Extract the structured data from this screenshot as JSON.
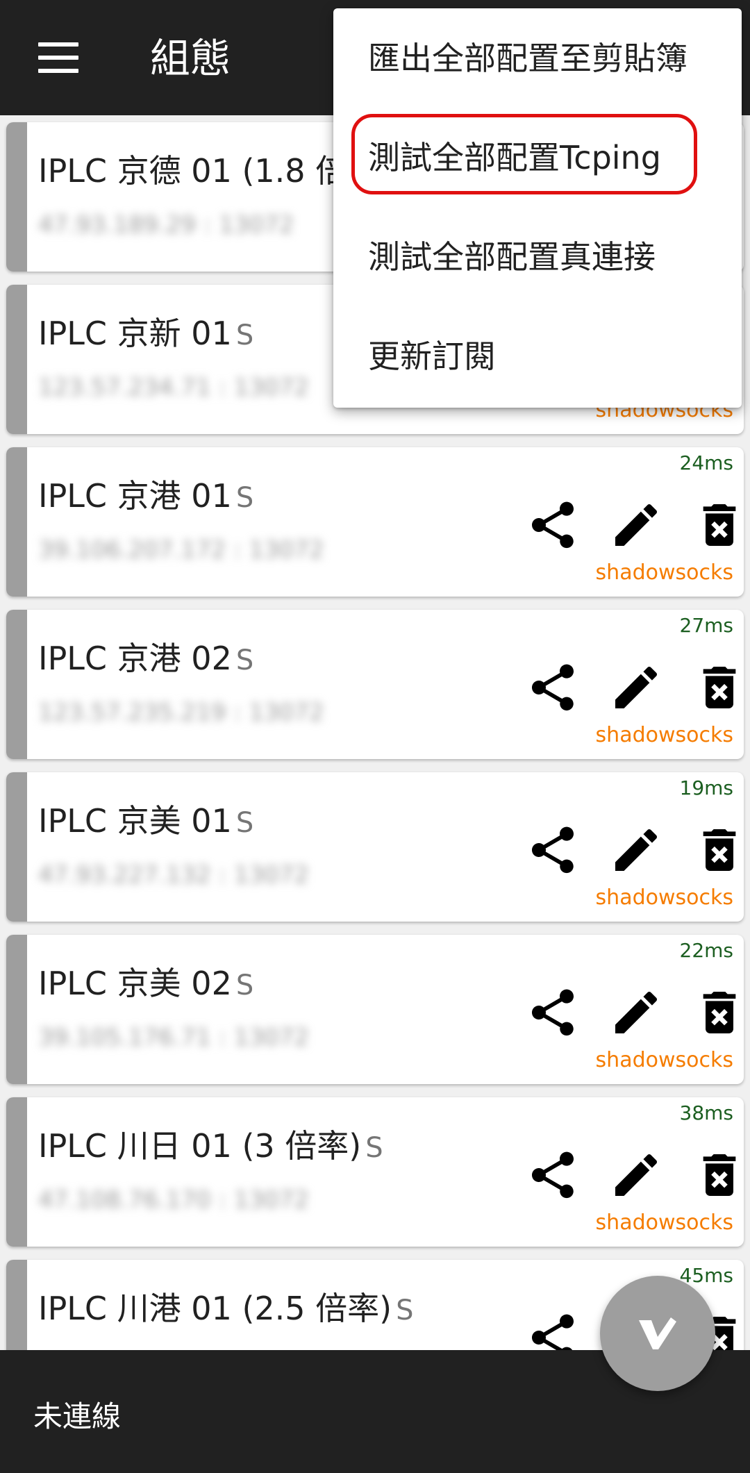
{
  "appbar": {
    "title": "組態",
    "menu_icon": "hamburger-menu-icon"
  },
  "profiles": [
    {
      "name": "IPLC 京德 01 (1.8 倍",
      "tag": "",
      "address": "47.93.189.29 : 13072",
      "latency": "",
      "type": ""
    },
    {
      "name": "IPLC 京新 01",
      "tag": "S",
      "address": "123.57.234.71 : 13072",
      "latency": "",
      "type": "shadowsocks"
    },
    {
      "name": "IPLC 京港 01",
      "tag": "S",
      "address": "39.106.207.172 : 13072",
      "latency": "24ms",
      "type": "shadowsocks"
    },
    {
      "name": "IPLC 京港 02",
      "tag": "S",
      "address": "123.57.235.219 : 13072",
      "latency": "27ms",
      "type": "shadowsocks"
    },
    {
      "name": "IPLC 京美 01",
      "tag": "S",
      "address": "47.93.227.132 : 13072",
      "latency": "19ms",
      "type": "shadowsocks"
    },
    {
      "name": "IPLC 京美 02",
      "tag": "S",
      "address": "39.105.176.71 : 13072",
      "latency": "22ms",
      "type": "shadowsocks"
    },
    {
      "name": "IPLC 川日 01 (3 倍率)",
      "tag": "S",
      "address": "47.108.76.170 : 13072",
      "latency": "38ms",
      "type": "shadowsocks"
    },
    {
      "name": "IPLC 川港 01 (2.5 倍率)",
      "tag": "S",
      "address": "",
      "latency": "45ms",
      "type": ""
    }
  ],
  "actions": {
    "share_icon": "share-icon",
    "edit_icon": "edit-pencil-icon",
    "delete_icon": "delete-icon"
  },
  "dropdown_menu": {
    "items": [
      {
        "label": "匯出全部配置至剪貼簿"
      },
      {
        "label": "測試全部配置Tcping",
        "highlighted": true
      },
      {
        "label": "測試全部配置真連接"
      },
      {
        "label": "更新訂閱"
      }
    ]
  },
  "status_bar": {
    "text": "未連線"
  },
  "fab": {
    "icon": "v2ray-logo-icon"
  },
  "colors": {
    "appbar": "#212121",
    "latency": "#1b5e20",
    "protocol": "#f57c00",
    "highlight": "#e01010",
    "fab": "#9e9e9e"
  }
}
